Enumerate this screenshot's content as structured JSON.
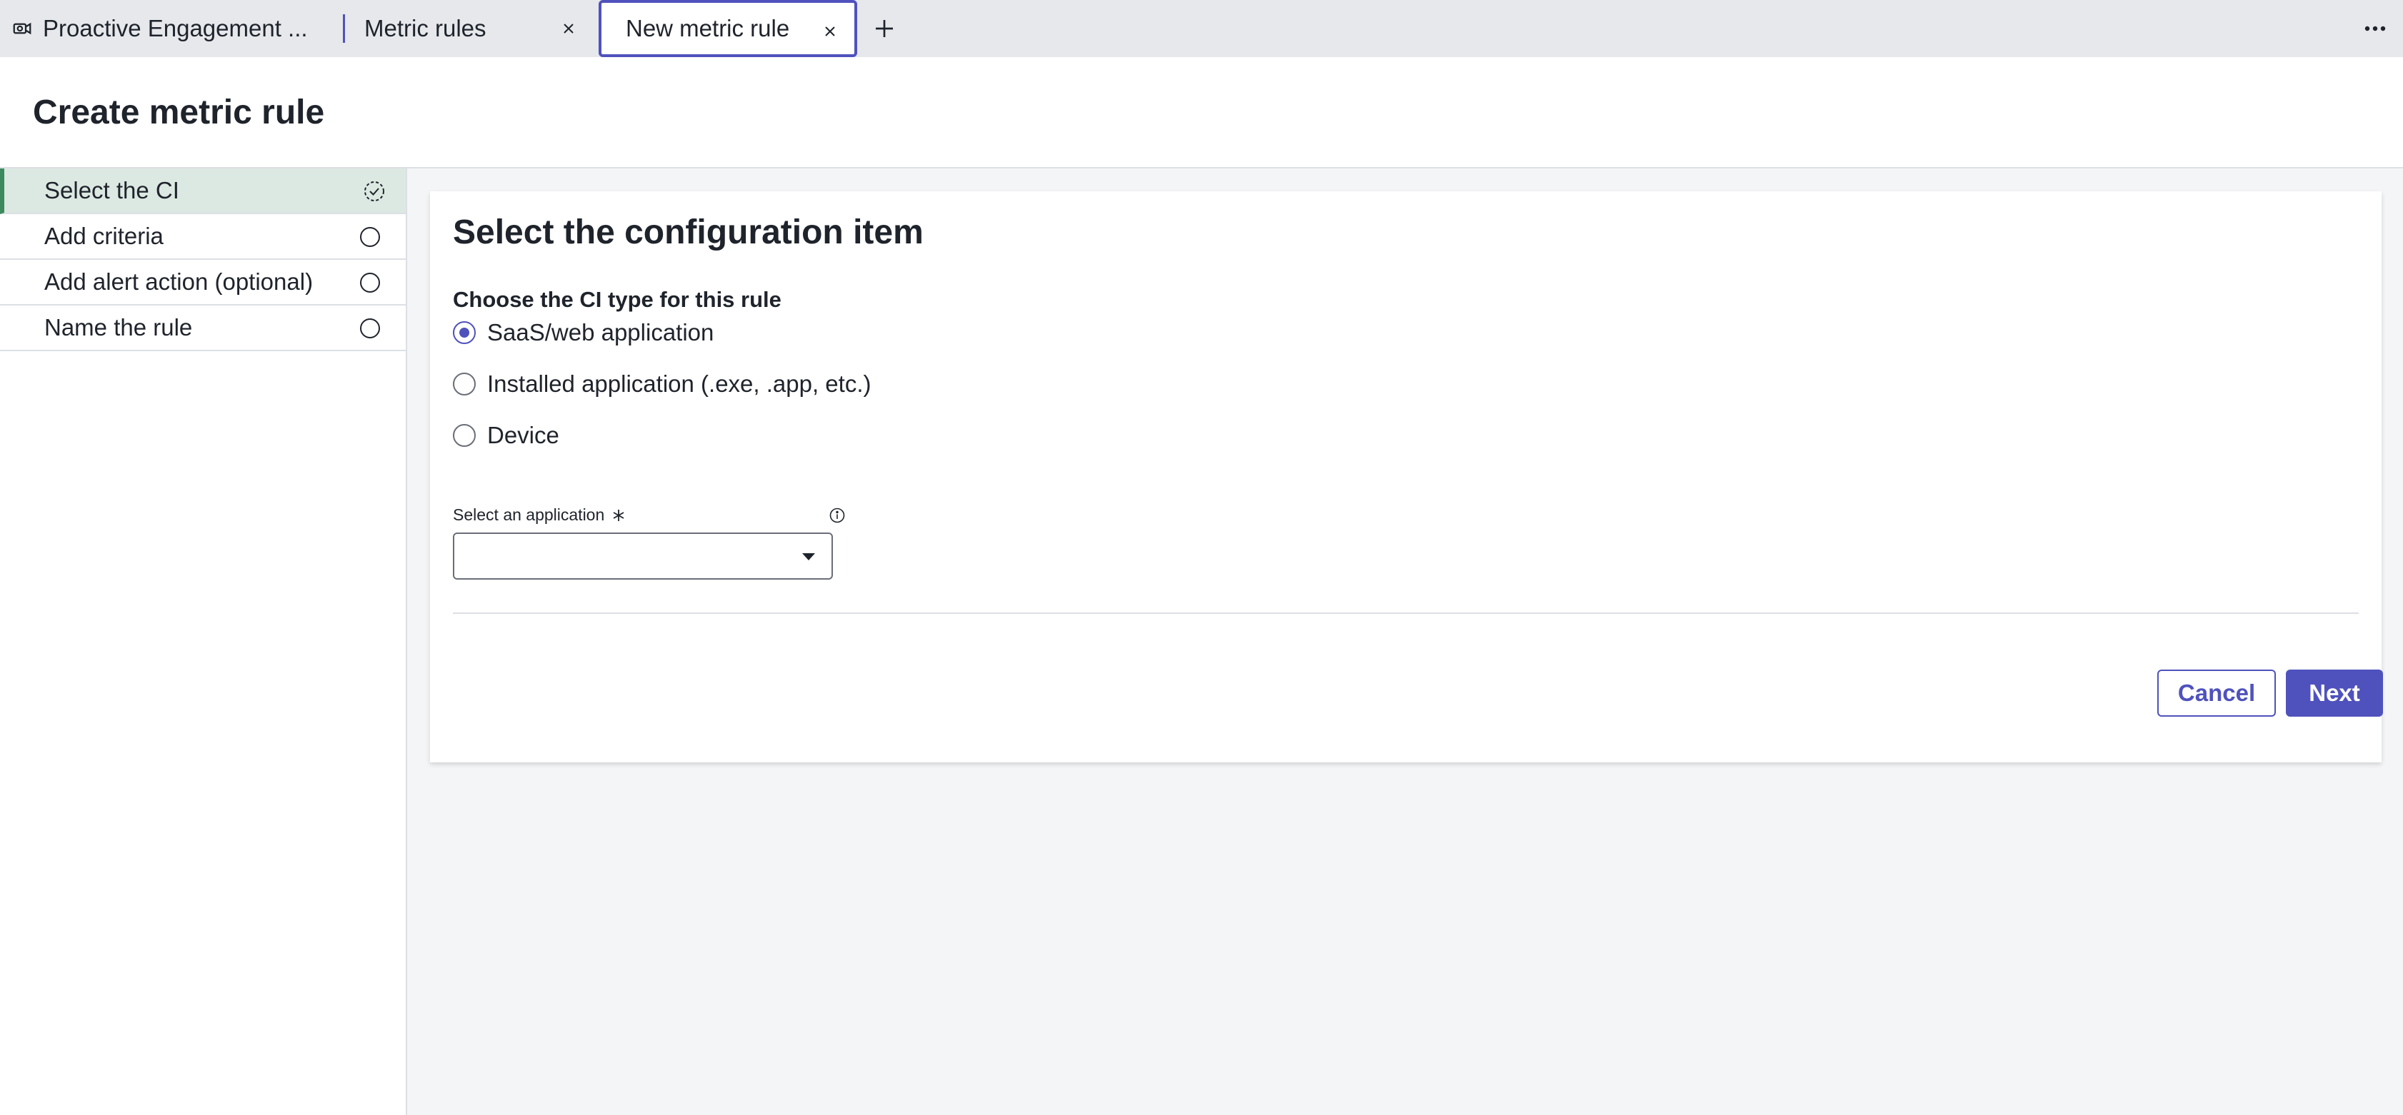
{
  "tabs": [
    {
      "label": "Proactive Engagement ..."
    },
    {
      "label": "Metric rules"
    },
    {
      "label": "New metric rule"
    }
  ],
  "header": {
    "title": "Create metric rule"
  },
  "steps": [
    {
      "label": "Select the CI"
    },
    {
      "label": "Add criteria"
    },
    {
      "label": "Add alert action (optional)"
    },
    {
      "label": "Name the rule"
    }
  ],
  "card": {
    "title": "Select the configuration item",
    "subtitle": "Choose the CI type for this rule",
    "options": [
      {
        "label": "SaaS/web application",
        "checked": true
      },
      {
        "label": "Installed application (.exe, .app, etc.)",
        "checked": false
      },
      {
        "label": "Device",
        "checked": false
      }
    ],
    "field_label": "Select an application",
    "field_value": ""
  },
  "buttons": {
    "cancel": "Cancel",
    "next": "Next"
  },
  "colors": {
    "accent": "#4f52bd",
    "active_step_bg": "#dce9e2",
    "active_step_bar": "#3d8a5e"
  }
}
